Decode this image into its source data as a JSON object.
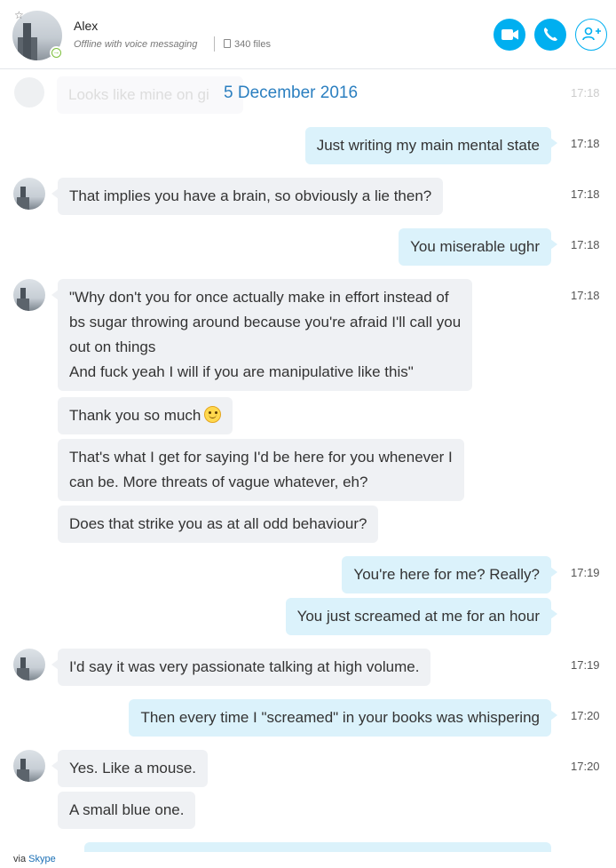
{
  "contact": {
    "name": "Alex",
    "status": "Offline with voice messaging",
    "files": "340 files"
  },
  "date_separator": "5 December 2016",
  "ghost_message": {
    "text": "Looks like mine on gi",
    "time": "17:18"
  },
  "messages": [
    {
      "dir": "out",
      "text": "Just writing my main mental state",
      "time": "17:18"
    },
    {
      "dir": "in",
      "text": "That implies you have a brain, so obviously a lie then?",
      "time": "17:18"
    },
    {
      "dir": "out",
      "text": "You miserable ughr",
      "time": "17:18"
    },
    {
      "dir": "in",
      "text": "\"Why don't you for once actually make in effort instead of\nbs sugar throwing around because you're afraid I'll call you\nout on things\nAnd fuck yeah I will if you are manipulative like this\"",
      "time": "17:18"
    },
    {
      "dir": "in",
      "text": "Thank you so much",
      "emoji": "smiley-emoji"
    },
    {
      "dir": "in",
      "text": "That's what I get for saying I'd be here for you whenever I\ncan be. More threats of vague whatever, eh?"
    },
    {
      "dir": "in",
      "text": "Does that strike you as at all odd behaviour?"
    },
    {
      "dir": "out",
      "text": "You're here for me? Really?",
      "time": "17:19"
    },
    {
      "dir": "out",
      "text": "You just screamed at me for an hour"
    },
    {
      "dir": "in",
      "text": "I'd say it was very passionate talking at high volume.",
      "time": "17:19"
    },
    {
      "dir": "out",
      "text": "Then every time I \"screamed\" in your books was whispering",
      "time": "17:20"
    },
    {
      "dir": "in",
      "text": "Yes. Like a mouse.",
      "time": "17:20"
    },
    {
      "dir": "in",
      "text": "A small blue one."
    }
  ],
  "footer": {
    "prefix": "via",
    "link": "Skype"
  },
  "colors": {
    "accent": "#00aff0",
    "outgoing": "#dbf2fb",
    "incoming": "#eff1f4",
    "date": "#2b7fc0"
  }
}
